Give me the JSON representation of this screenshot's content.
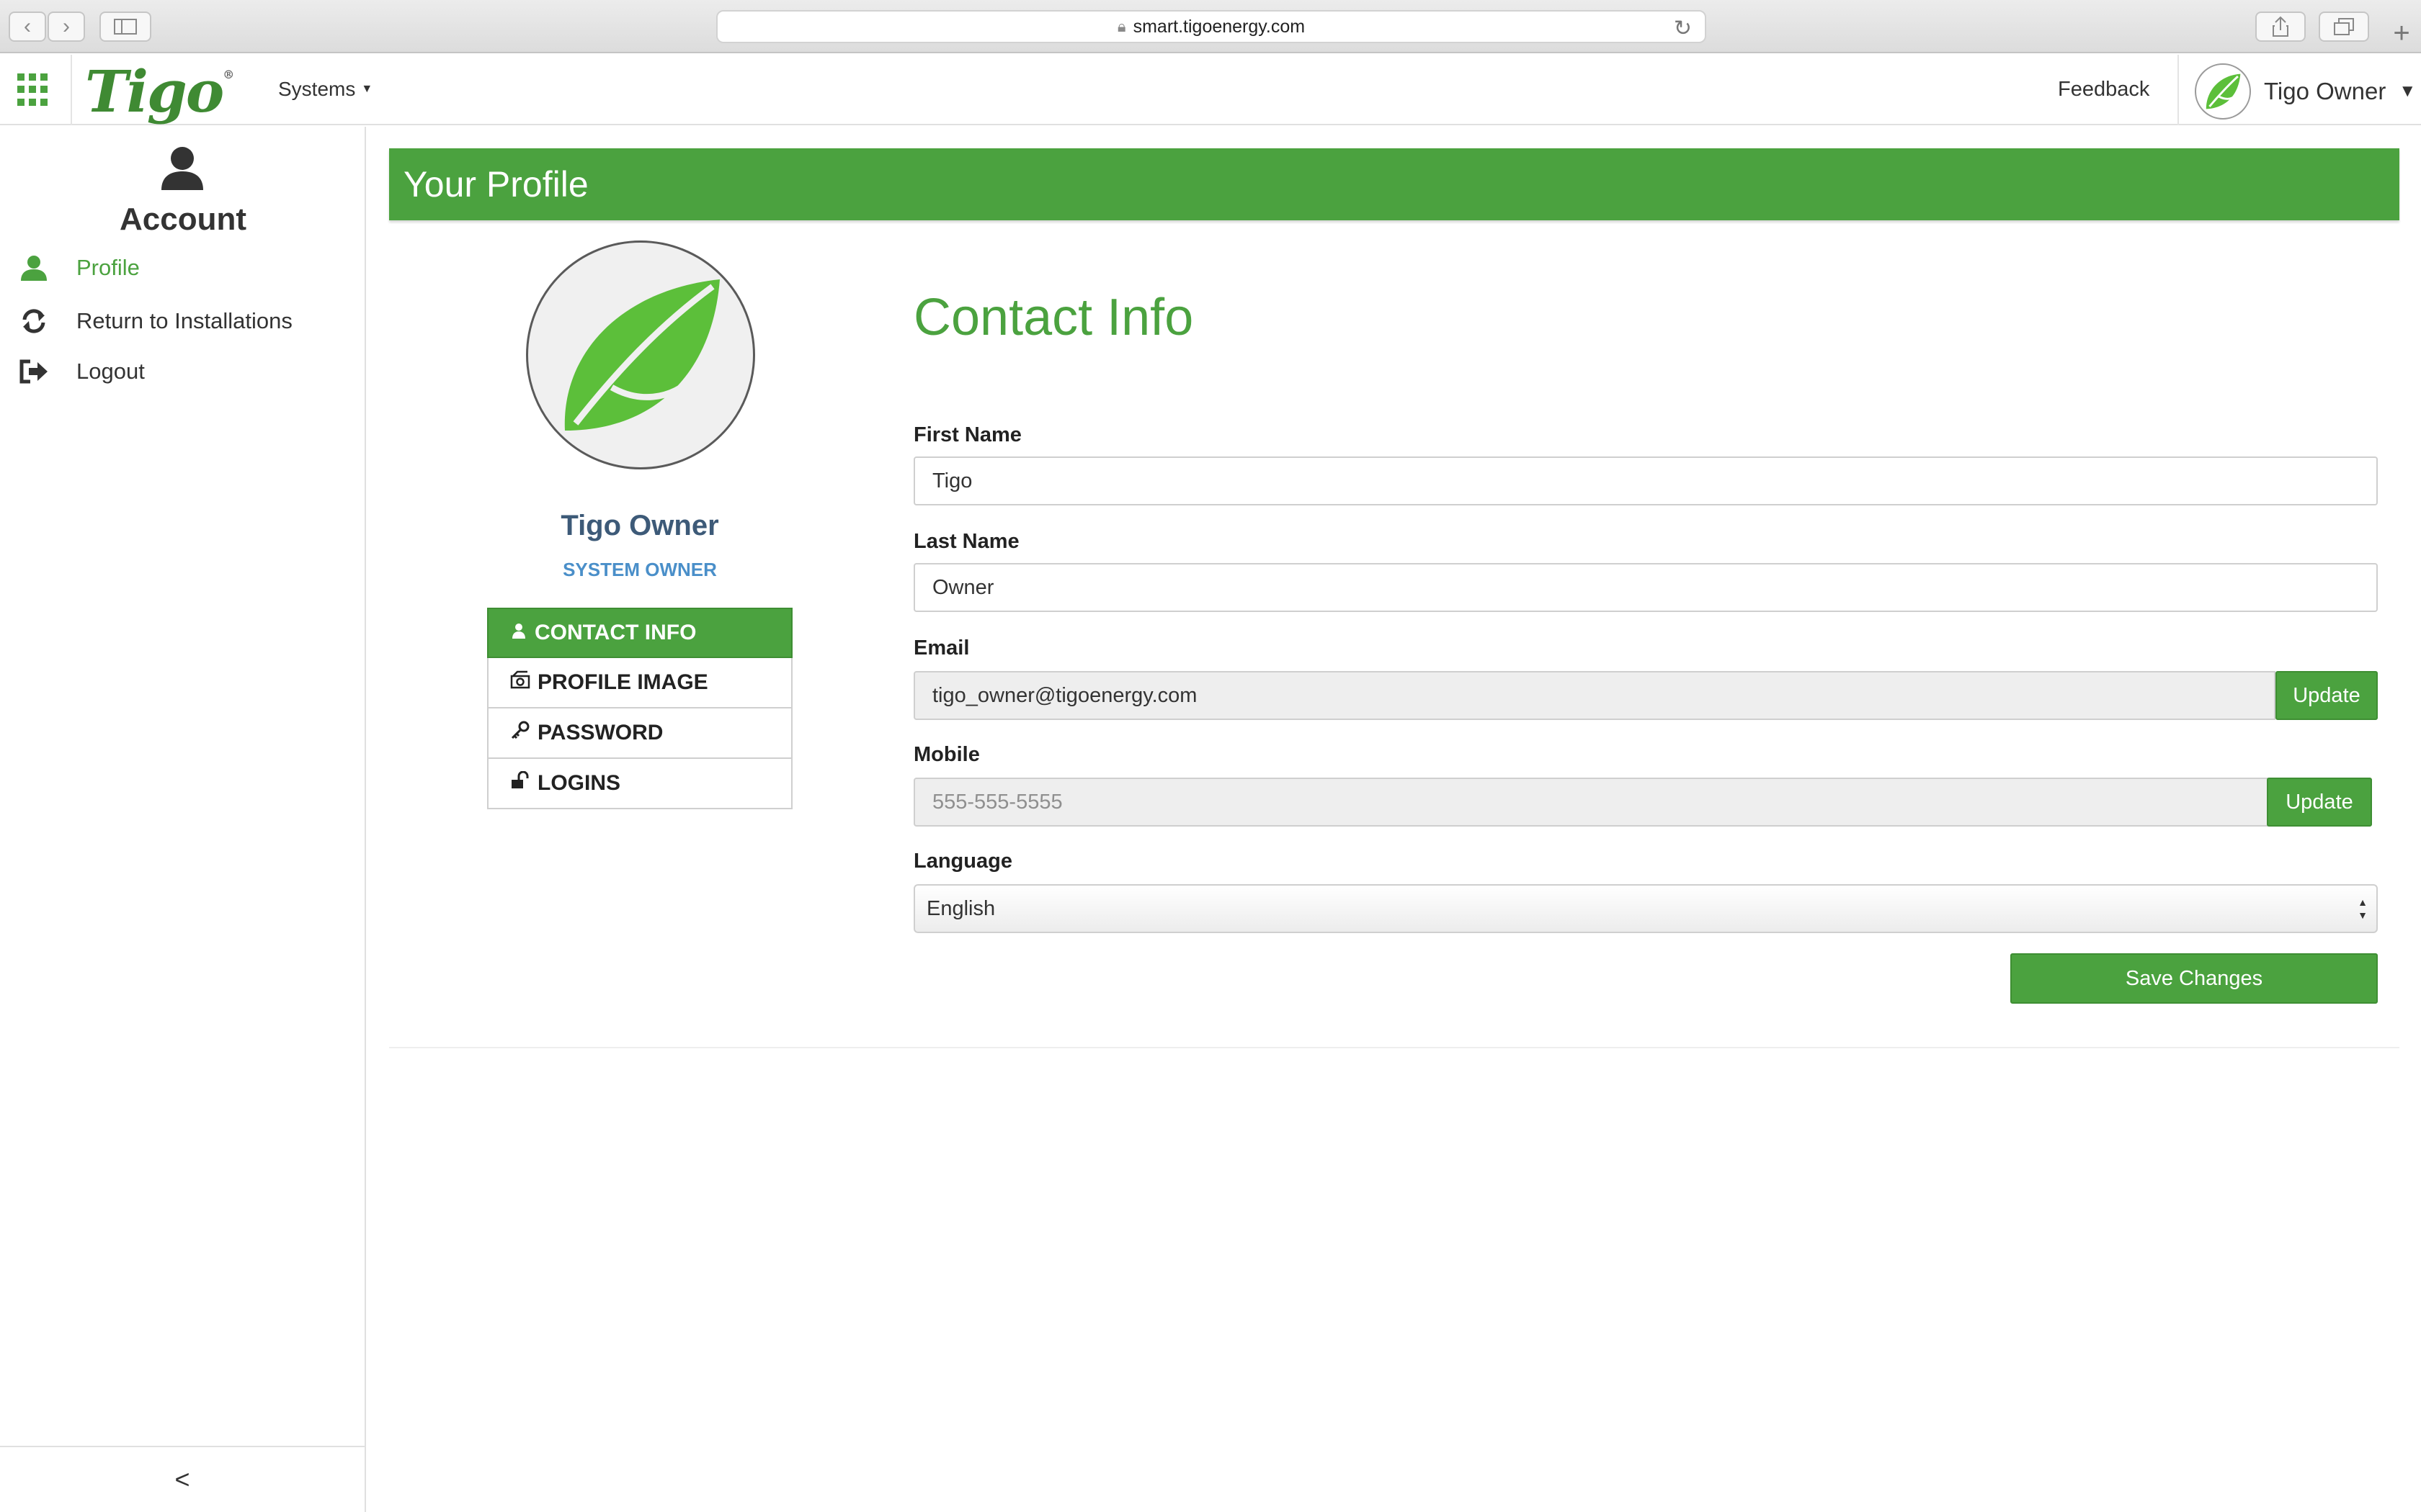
{
  "browser": {
    "url": "smart.tigoenergy.com",
    "back_glyph": "‹",
    "forward_glyph": "›"
  },
  "header": {
    "logo_text": "Tigo",
    "logo_mark": "®",
    "systems_label": "Systems",
    "feedback_label": "Feedback",
    "user_name": "Tigo Owner",
    "brand_color": "#4ba23f"
  },
  "sidebar": {
    "title": "Account",
    "items": [
      {
        "label": "Profile",
        "icon": "user-icon",
        "active": true
      },
      {
        "label": "Return to Installations",
        "icon": "refresh-icon",
        "active": false
      },
      {
        "label": "Logout",
        "icon": "logout-icon",
        "active": false
      }
    ],
    "collapse_glyph": "<"
  },
  "main": {
    "banner_title": "Your Profile",
    "profile": {
      "name": "Tigo Owner",
      "role": "SYSTEM OWNER",
      "tabs": [
        {
          "label": "CONTACT INFO",
          "icon": "user-icon",
          "active": true
        },
        {
          "label": "PROFILE IMAGE",
          "icon": "camera-icon",
          "active": false
        },
        {
          "label": "PASSWORD",
          "icon": "key-icon",
          "active": false
        },
        {
          "label": "LOGINS",
          "icon": "unlock-icon",
          "active": false
        }
      ]
    },
    "form": {
      "title": "Contact Info",
      "first_name_label": "First Name",
      "first_name_value": "Tigo",
      "last_name_label": "Last Name",
      "last_name_value": "Owner",
      "email_label": "Email",
      "email_value": "tigo_owner@tigoenergy.com",
      "email_button": "Update",
      "mobile_label": "Mobile",
      "mobile_placeholder": "555-555-5555",
      "mobile_button": "Update",
      "language_label": "Language",
      "language_value": "English",
      "save_button": "Save Changes"
    }
  }
}
